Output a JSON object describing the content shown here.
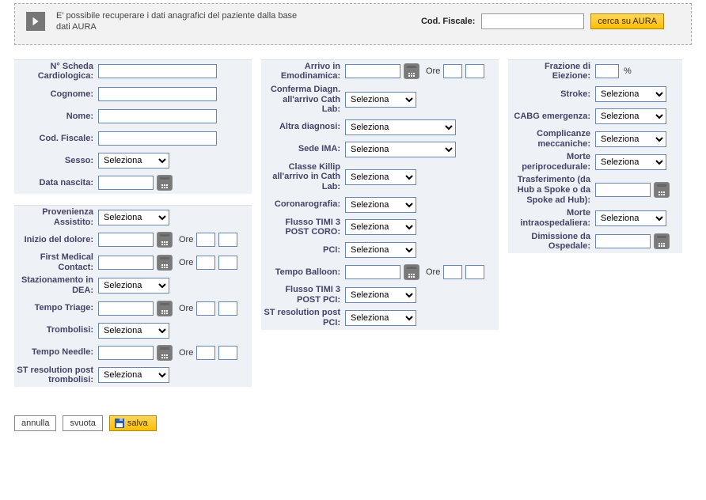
{
  "top": {
    "hint": "E' possibile recuperare i dati anagrafici del paziente dalla base dati AURA",
    "cod_fiscale_label": "Cod. Fiscale:",
    "cod_fiscale_value": "",
    "search_btn": "cerca su AURA"
  },
  "labels": {
    "ore": "Ore",
    "percent": "%"
  },
  "select_default": "Seleziona",
  "col1": {
    "scheda": "N° Scheda Cardiologica:",
    "cognome": "Cognome:",
    "nome": "Nome:",
    "cod_fiscale": "Cod. Fiscale:",
    "sesso": "Sesso:",
    "data_nascita": "Data nascita:",
    "provenienza": "Provenienza Assistito:",
    "inizio_dolore": "Inizio del dolore:",
    "fmc": "First Medical Contact:",
    "stazionamento": "Stazionamento in DEA:",
    "tempo_triage": "Tempo Triage:",
    "trombolisi": "Trombolisi:",
    "tempo_needle": "Tempo Needle:",
    "st_res_tromb": "ST resolution post trombolisi:"
  },
  "col2": {
    "arrivo_emo": "Arrivo in Emodinamica:",
    "conferma_diagn": "Conferma Diagn. all'arrivo Cath Lab:",
    "altra_diagnosi": "Altra diagnosi:",
    "sede_ima": "Sede IMA:",
    "classe_killip": "Classe Killip all'arrivo in Cath Lab:",
    "coronarografia": "Coronarografia:",
    "timi3_coro": "Flusso TIMI 3 POST CORO:",
    "pci": "PCI:",
    "tempo_balloon": "Tempo Balloon:",
    "timi3_pci": "Flusso TIMI 3 POST PCI:",
    "st_res_pci": "ST resolution post PCI:"
  },
  "col3": {
    "fe": "Frazione di Eiezione:",
    "stroke": "Stroke:",
    "cabg": "CABG emergenza:",
    "complicanze": "Complicanze meccaniche:",
    "morte_peri": "Morte periprocedurale:",
    "trasferimento": "Trasferimento (da Hub a Spoke o da Spoke ad Hub):",
    "morte_intra": "Morte intraospedaliera:",
    "dimissione": "Dimissione da Ospedale:"
  },
  "buttons": {
    "annulla": "annulla",
    "svuota": "svuota",
    "salva": "salva"
  }
}
